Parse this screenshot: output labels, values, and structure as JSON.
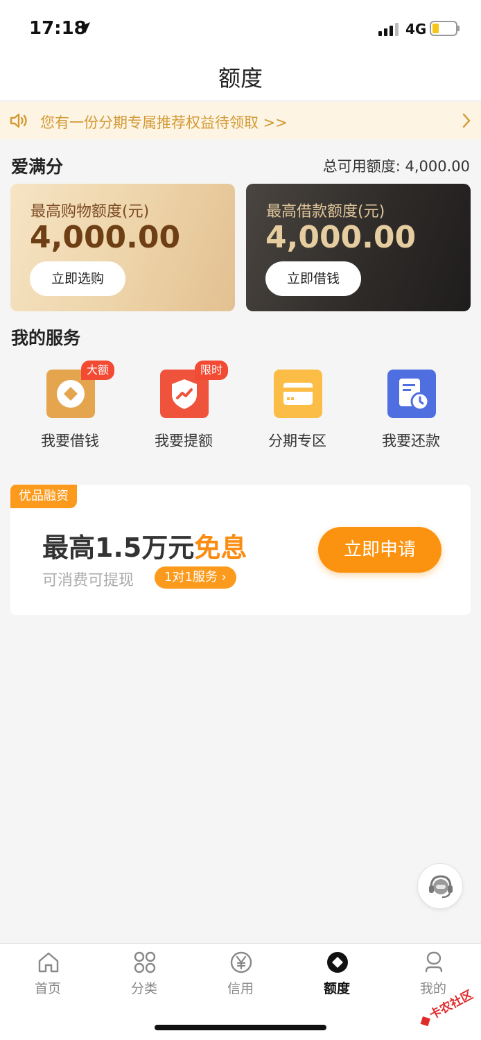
{
  "status_bar": {
    "time": "17:18",
    "network": "4G"
  },
  "nav": {
    "title": "额度"
  },
  "notice": {
    "text": "您有一份分期专属推荐权益待领取 >>"
  },
  "summary": {
    "section_title": "爱满分",
    "total_limit_label": "总可用额度: 4,000.00"
  },
  "cards": {
    "shopping": {
      "label": "最高购物额度(元)",
      "amount": "4,000.00",
      "button": "立即选购"
    },
    "loan": {
      "label": "最高借款额度(元)",
      "amount": "4,000.00",
      "button": "立即借钱"
    }
  },
  "services": {
    "title": "我的服务",
    "items": [
      {
        "label": "我要借钱",
        "badge": "大额",
        "color": "#e4a54e"
      },
      {
        "label": "我要提额",
        "badge": "限时",
        "color": "#f0533c"
      },
      {
        "label": "分期专区",
        "badge": "",
        "color": "#fbbd45"
      },
      {
        "label": "我要还款",
        "badge": "",
        "color": "#4f6ee0"
      }
    ]
  },
  "promo": {
    "tag": "优品融资",
    "headline_prefix": "最高1.5万元",
    "headline_highlight": "免息",
    "subtext": "可消费可提现",
    "chip": "1对1服务 ›",
    "button": "立即申请"
  },
  "tabbar": {
    "items": [
      {
        "label": "首页",
        "icon": "home-icon"
      },
      {
        "label": "分类",
        "icon": "category-icon"
      },
      {
        "label": "信用",
        "icon": "credit-yen-icon"
      },
      {
        "label": "额度",
        "icon": "limit-diamond-icon",
        "active": true
      },
      {
        "label": "我的",
        "icon": "profile-icon"
      }
    ]
  },
  "watermark": {
    "text": "卡农社区"
  },
  "colors": {
    "accent": "#fb9310",
    "notice_text": "#d29a35",
    "badge": "#f24a33"
  }
}
